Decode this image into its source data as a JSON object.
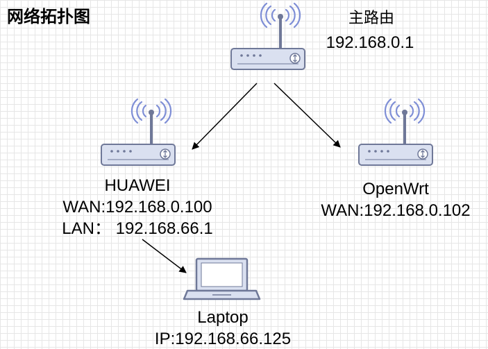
{
  "title": "网络拓扑图",
  "nodes": {
    "main_router": {
      "name": "主路由",
      "ip": "192.168.0.1"
    },
    "huawei": {
      "name": "HUAWEI",
      "wan": "WAN:192.168.0.100",
      "lan": "LAN： 192.168.66.1"
    },
    "openwrt": {
      "name": "OpenWrt",
      "wan": "WAN:192.168.0.102"
    },
    "laptop": {
      "name": "Laptop",
      "ip": "IP:192.168.66.125"
    }
  },
  "connections": [
    {
      "from": "主路由",
      "to": "HUAWEI"
    },
    {
      "from": "主路由",
      "to": "OpenWrt"
    },
    {
      "from": "HUAWEI",
      "to": "Laptop"
    }
  ],
  "colors": {
    "device_fill": "#dae0f0",
    "device_stroke": "#6f7898",
    "antenna": "#6f7898",
    "wave": "#7f8fd6",
    "grid": "#e6e6e6"
  }
}
